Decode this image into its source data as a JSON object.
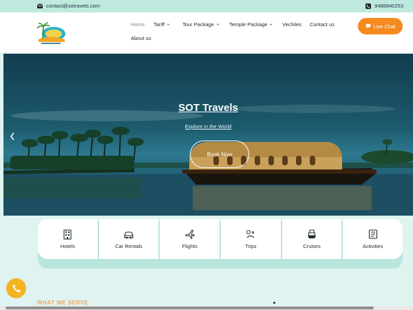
{
  "topbar": {
    "email": "contact@sotravels.com",
    "phone": "9488840253"
  },
  "nav": {
    "items": [
      {
        "label": "Home"
      },
      {
        "label": "Tariff"
      },
      {
        "label": "Tour Package"
      },
      {
        "label": "Temple Package"
      },
      {
        "label": "Vechiles"
      },
      {
        "label": "Contact us"
      },
      {
        "label": "About us"
      }
    ],
    "chat_label": "Live Chat"
  },
  "hero": {
    "title": "SOT Travels",
    "subtitle": "Explore in the World",
    "button": "Book Now"
  },
  "services": [
    {
      "label": "Hotels",
      "icon": "hotel-icon"
    },
    {
      "label": "Car Rentals",
      "icon": "car-icon"
    },
    {
      "label": "Flights",
      "icon": "flight-icon"
    },
    {
      "label": "Trips",
      "icon": "trip-icon"
    },
    {
      "label": "Cruises",
      "icon": "cruise-icon"
    },
    {
      "label": "Activities",
      "icon": "activities-icon"
    }
  ],
  "section": {
    "heading": "WHAT WE SERVE"
  },
  "colors": {
    "accent": "#f58a1f",
    "topbar": "#bfe9df",
    "hero": "#1c5a6c",
    "phone_button": "#f4b323"
  }
}
